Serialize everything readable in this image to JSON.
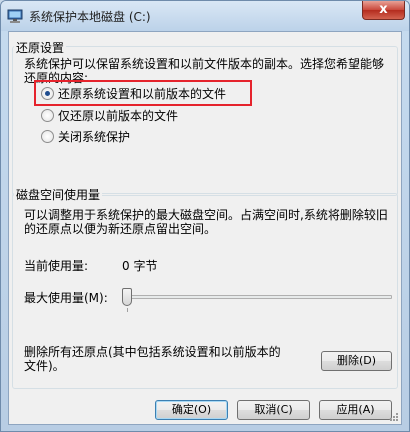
{
  "window": {
    "title": "系统保护本地磁盘 (C:)",
    "close_glyph": "x"
  },
  "restore_settings": {
    "group_label": "还原设置",
    "description": "系统保护可以保留系统设置和以前文件版本的副本。选择您希望能够还原的内容:",
    "options": [
      {
        "label": "还原系统设置和以前版本的文件",
        "checked": true
      },
      {
        "label": "仅还原以前版本的文件",
        "checked": false
      },
      {
        "label": "关闭系统保护",
        "checked": false
      }
    ]
  },
  "disk_usage": {
    "group_label": "磁盘空间使用量",
    "description": "可以调整用于系统保护的最大磁盘空间。占满空间时,系统将删除较旧的还原点以便为新还原点留出空间。",
    "current_usage_label": "当前使用量:",
    "current_usage_value": "0 字节",
    "max_usage_label": "最大使用量(M):",
    "max_usage_fraction": 0.0
  },
  "delete_section": {
    "description": "删除所有还原点(其中包括系统设置和以前版本的文件)。",
    "delete_label": "删除(D)"
  },
  "footer": {
    "ok_label": "确定(O)",
    "cancel_label": "取消(C)",
    "apply_label": "应用(A)"
  },
  "colors": {
    "highlight_box": "#e5232c",
    "selected_radio": "#1f4d8f"
  }
}
